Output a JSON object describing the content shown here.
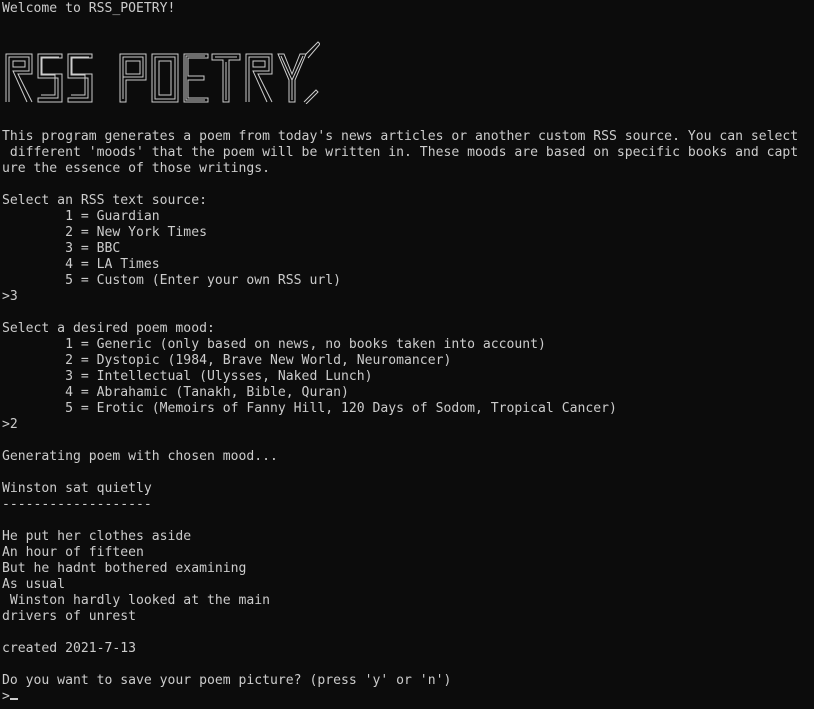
{
  "colors": {
    "background": "#0c0c0c",
    "text": "#cccccc"
  },
  "terminal": {
    "welcome": "Welcome to RSS_POETRY!",
    "banner": {
      "text": "RSS POETRY",
      "style": "double-line ASCII art logo"
    },
    "intro": [
      "This program generates a poem from today's news articles or another custom RSS source. You can select",
      " different 'moods' that the poem will be written in. These moods are based on specific books and capt",
      "ure the essence of those writings."
    ],
    "source_prompt": "Select an RSS text source:",
    "sources": [
      "        1 = Guardian",
      "        2 = New York Times",
      "        3 = BBC",
      "        4 = LA Times",
      "        5 = Custom (Enter your own RSS url)"
    ],
    "source_answer": ">3",
    "mood_prompt": "Select a desired poem mood:",
    "moods": [
      "        1 = Generic (only based on news, no books taken into account)",
      "        2 = Dystopic (1984, Brave New World, Neuromancer)",
      "        3 = Intellectual (Ulysses, Naked Lunch)",
      "        4 = Abrahamic (Tanakh, Bible, Quran)",
      "        5 = Erotic (Memoirs of Fanny Hill, 120 Days of Sodom, Tropical Cancer)"
    ],
    "mood_answer": ">2",
    "generating": "Generating poem with chosen mood...",
    "poem_title": "Winston sat quietly",
    "poem_rule": "-------------------",
    "poem_lines": [
      "He put her clothes aside",
      "An hour of fifteen",
      "But he hadnt bothered examining",
      "As usual",
      " Winston hardly looked at the main",
      "drivers of unrest"
    ],
    "created": "created 2021-7-13",
    "save_prompt": "Do you want to save your poem picture? (press 'y' or 'n')",
    "input_prompt": ">"
  }
}
